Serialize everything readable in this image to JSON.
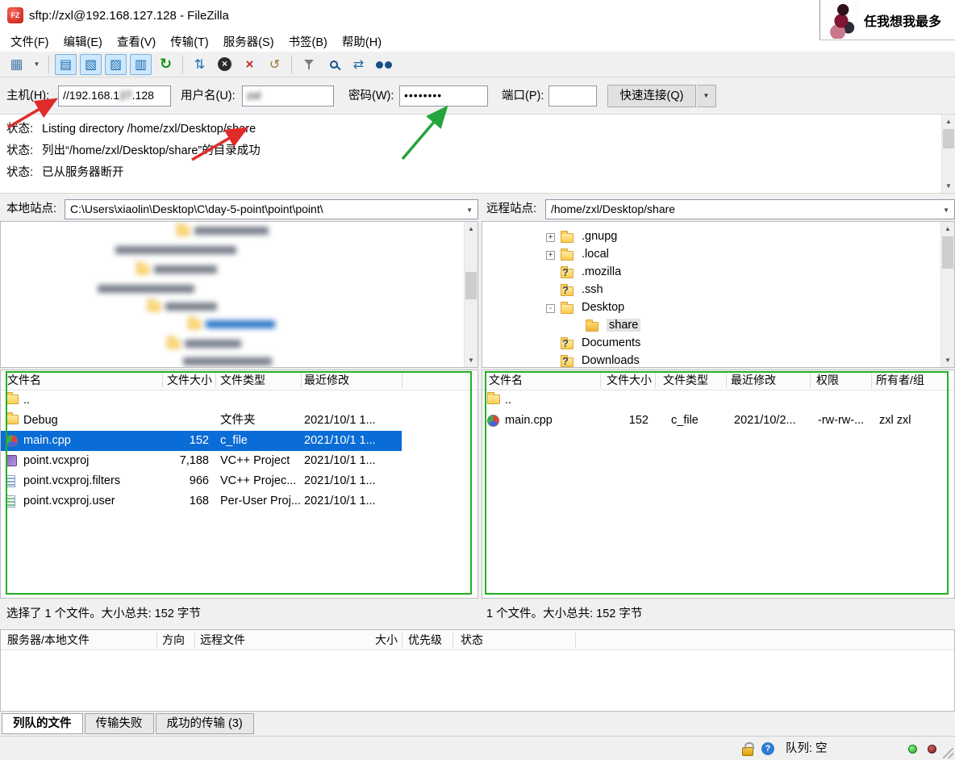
{
  "window": {
    "title": "sftp://zxl@192.168.127.128 - FileZilla"
  },
  "overlay": {
    "caption": "任我想我最多"
  },
  "menu": {
    "items": [
      "文件(F)",
      "编辑(E)",
      "查看(V)",
      "传输(T)",
      "服务器(S)",
      "书签(B)",
      "帮助(H)"
    ]
  },
  "toolbar": {
    "icons": [
      {
        "name": "site-manager-icon",
        "glyph": "▦"
      },
      {
        "name": "message-log-toggle-icon",
        "glyph": "▤"
      },
      {
        "name": "local-tree-toggle-icon",
        "glyph": "▧"
      },
      {
        "name": "remote-tree-toggle-icon",
        "glyph": "▨"
      },
      {
        "name": "queue-toggle-icon",
        "glyph": "▥"
      },
      {
        "name": "refresh-icon",
        "glyph": "↻"
      },
      {
        "name": "process-queue-icon",
        "glyph": "⇅"
      },
      {
        "name": "cancel-icon",
        "glyph": "×"
      },
      {
        "name": "disconnect-icon",
        "glyph": "×"
      },
      {
        "name": "reconnect-icon",
        "glyph": "↺"
      },
      {
        "name": "filter-icon",
        "glyph": ""
      },
      {
        "name": "compare-icon",
        "glyph": ""
      },
      {
        "name": "sync-browse-icon",
        "glyph": "⇄"
      },
      {
        "name": "find-icon",
        "glyph": ""
      }
    ]
  },
  "quickconnect": {
    "host_label": "主机(H):",
    "host_prefix": "//192.168.1",
    "host_blurred": "27",
    "host_suffix": ".128",
    "user_label": "用户名(U):",
    "user_value": "zxl",
    "pass_label": "密码(W):",
    "pass_value": "••••••••",
    "port_label": "端口(P):",
    "port_value": "",
    "quickconnect_label": "快速连接(Q)"
  },
  "log": {
    "lines": [
      {
        "label": "状态:",
        "text": "Listing directory /home/zxl/Desktop/share"
      },
      {
        "label": "状态:",
        "text": "列出“/home/zxl/Desktop/share”的目录成功"
      },
      {
        "label": "状态:",
        "text": "已从服务器断开"
      }
    ]
  },
  "sites": {
    "local_label": "本地站点:",
    "local_path": "C:\\Users\\xiaolin\\Desktop\\C\\day-5-point\\point\\point\\",
    "remote_label": "远程站点:",
    "remote_path": "/home/zxl/Desktop/share"
  },
  "remote_tree": {
    "items": [
      {
        "expander": "+",
        "label": ".gnupg"
      },
      {
        "expander": "+",
        "label": ".local"
      },
      {
        "expander": "?",
        "label": ".mozilla"
      },
      {
        "expander": "?",
        "label": ".ssh"
      },
      {
        "expander": "-",
        "label": "Desktop"
      },
      {
        "expander": "",
        "label": "share",
        "selected": true
      },
      {
        "expander": "?",
        "label": "Documents"
      },
      {
        "expander": "?",
        "label": "Downloads"
      }
    ]
  },
  "local_list": {
    "headers": [
      "文件名",
      "文件大小",
      "文件类型",
      "最近修改"
    ],
    "rows": [
      {
        "name": "..",
        "size": "",
        "type": "",
        "modified": ""
      },
      {
        "name": "Debug",
        "size": "",
        "type": "文件夹",
        "modified": "2021/10/1 1..."
      },
      {
        "name": "main.cpp",
        "size": "152",
        "type": "c_file",
        "modified": "2021/10/1 1...",
        "selected": true
      },
      {
        "name": "point.vcxproj",
        "size": "7,188",
        "type": "VC++ Project",
        "modified": "2021/10/1 1..."
      },
      {
        "name": "point.vcxproj.filters",
        "size": "966",
        "type": "VC++ Projec...",
        "modified": "2021/10/1 1..."
      },
      {
        "name": "point.vcxproj.user",
        "size": "168",
        "type": "Per-User Proj...",
        "modified": "2021/10/1 1..."
      }
    ],
    "status": "选择了 1 个文件。大小总共: 152 字节"
  },
  "remote_list": {
    "headers": [
      "文件名",
      "文件大小",
      "文件类型",
      "最近修改",
      "权限",
      "所有者/组"
    ],
    "rows": [
      {
        "name": "..",
        "size": "",
        "type": "",
        "modified": "",
        "perms": "",
        "owner": ""
      },
      {
        "name": "main.cpp",
        "size": "152",
        "type": "c_file",
        "modified": "2021/10/2...",
        "perms": "-rw-rw-...",
        "owner": "zxl zxl"
      }
    ],
    "status": "1 个文件。大小总共: 152 字节"
  },
  "queue": {
    "headers": [
      "服务器/本地文件",
      "方向",
      "远程文件",
      "大小",
      "优先级",
      "状态"
    ],
    "tabs": [
      {
        "label": "列队的文件",
        "active": true
      },
      {
        "label": "传输失败",
        "active": false
      },
      {
        "label": "成功的传输 (3)",
        "active": false
      }
    ]
  },
  "statusbar": {
    "queue_status": "队列: 空"
  }
}
